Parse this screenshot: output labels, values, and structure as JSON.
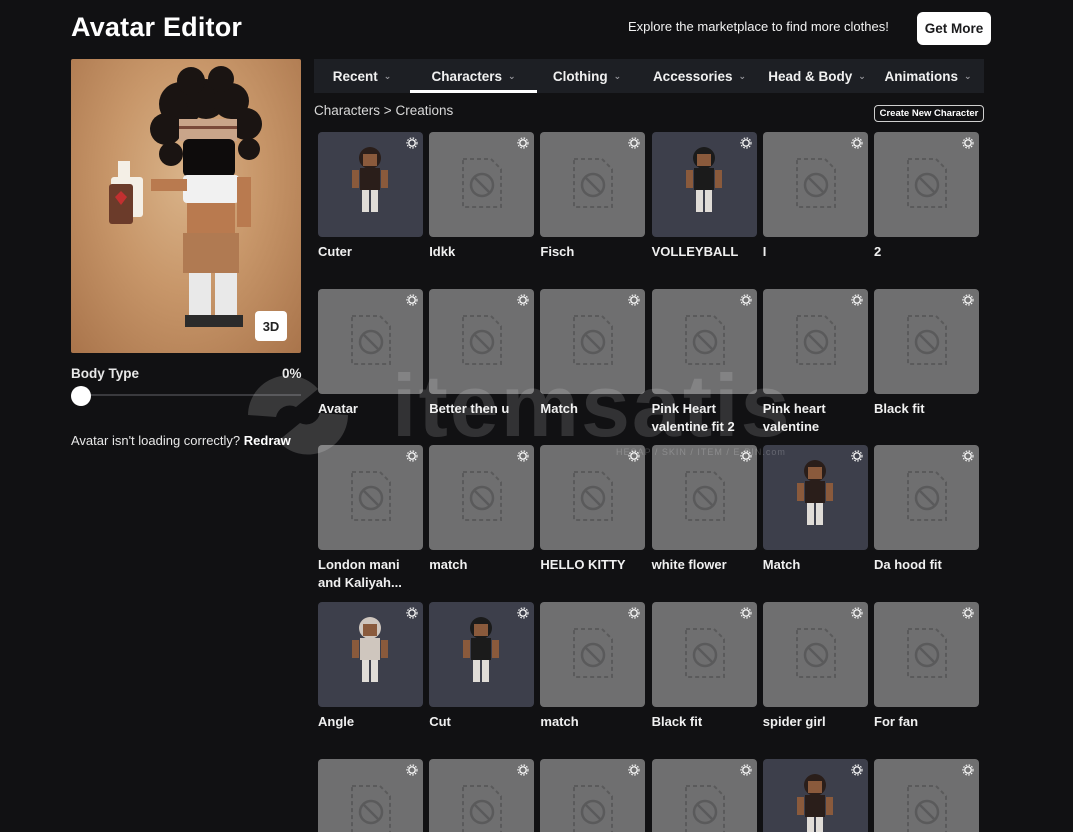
{
  "header": {
    "title": "Avatar Editor",
    "promo_text": "Explore the marketplace to find more clothes!",
    "get_more_label": "Get More"
  },
  "preview": {
    "toggle_3d_label": "3D"
  },
  "body_type": {
    "label": "Body Type",
    "value": "0%",
    "level": 0
  },
  "loading_help": {
    "text": "Avatar isn't loading correctly?",
    "link": "Redraw"
  },
  "tabs": [
    {
      "label": "Recent",
      "active": false
    },
    {
      "label": "Characters",
      "active": true
    },
    {
      "label": "Clothing",
      "active": false
    },
    {
      "label": "Accessories",
      "active": false
    },
    {
      "label": "Head & Body",
      "active": false
    },
    {
      "label": "Animations",
      "active": false
    }
  ],
  "breadcrumb": {
    "parent": "Characters",
    "separator": ">",
    "current": "Creations"
  },
  "create_button_label": "Create New Character",
  "watermark": {
    "brand": "itemsatis",
    "sub": "HESAP / SKIN / ITEM / E-PIN",
    "domain": ".com"
  },
  "characters": [
    {
      "name": "Cuter",
      "has_thumbnail": true
    },
    {
      "name": "Idkk",
      "has_thumbnail": false
    },
    {
      "name": "Fisch",
      "has_thumbnail": false
    },
    {
      "name": "VOLLEYBALL",
      "has_thumbnail": true
    },
    {
      "name": "I",
      "has_thumbnail": false
    },
    {
      "name": "2",
      "has_thumbnail": false
    },
    {
      "name": "Avatar",
      "has_thumbnail": false
    },
    {
      "name": "Better then u",
      "has_thumbnail": false
    },
    {
      "name": "Match",
      "has_thumbnail": false
    },
    {
      "name": "Pink Heart valentine fit 2",
      "has_thumbnail": false
    },
    {
      "name": "Pink heart valentine",
      "has_thumbnail": false
    },
    {
      "name": "Black fit",
      "has_thumbnail": false
    },
    {
      "name": "London mani and Kaliyah...",
      "has_thumbnail": false
    },
    {
      "name": "match",
      "has_thumbnail": false
    },
    {
      "name": "HELLO KITTY",
      "has_thumbnail": false
    },
    {
      "name": "white flower",
      "has_thumbnail": false
    },
    {
      "name": "Match",
      "has_thumbnail": true
    },
    {
      "name": "Da hood fit",
      "has_thumbnail": false
    },
    {
      "name": "Angle",
      "has_thumbnail": true
    },
    {
      "name": "Cut",
      "has_thumbnail": true
    },
    {
      "name": "match",
      "has_thumbnail": false
    },
    {
      "name": "Black fit",
      "has_thumbnail": false
    },
    {
      "name": "spider girl",
      "has_thumbnail": false
    },
    {
      "name": "For fan",
      "has_thumbnail": false
    },
    {
      "name": "",
      "has_thumbnail": false
    },
    {
      "name": "",
      "has_thumbnail": false
    },
    {
      "name": "",
      "has_thumbnail": false
    },
    {
      "name": "",
      "has_thumbnail": false
    },
    {
      "name": "",
      "has_thumbnail": true
    },
    {
      "name": "",
      "has_thumbnail": false
    }
  ],
  "colors": {
    "background": "#111113",
    "tab_bar": "#1d1f24",
    "placeholder_tile": "#6f6f70",
    "thumbnail_tile": "#3d3f4b",
    "preview_bg": "#c8976a"
  }
}
